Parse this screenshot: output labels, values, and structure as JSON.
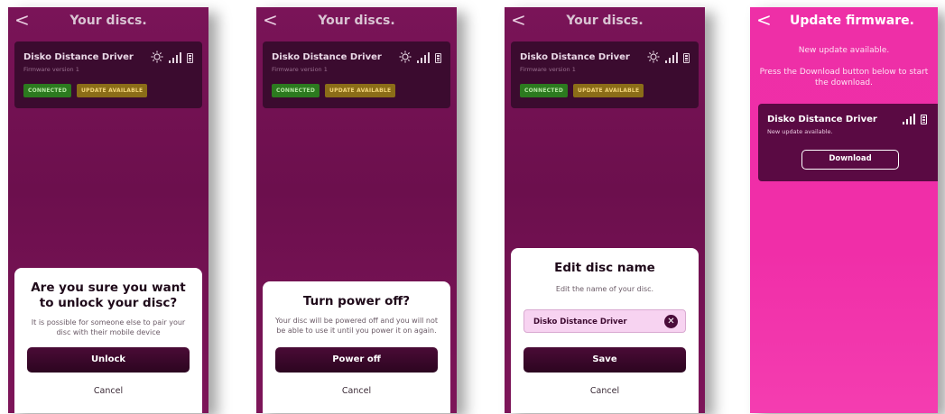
{
  "screens": [
    {
      "back": "<",
      "title": "Your discs.",
      "device": {
        "name": "Disko Distance Driver",
        "firmware": "Firmware version 1",
        "badge_connected": "CONNECTED",
        "badge_update": "UPDATE AVAILABLE"
      },
      "dialog": {
        "title": "Are you sure you want to unlock your disc?",
        "message": "It is possible for someone else to pair your disc with their mobile device",
        "primary": "Unlock",
        "cancel": "Cancel"
      }
    },
    {
      "back": "<",
      "title": "Your discs.",
      "device": {
        "name": "Disko Distance Driver",
        "firmware": "Firmware version 1",
        "badge_connected": "CONNECTED",
        "badge_update": "UPDATE AVAILABLE"
      },
      "dialog": {
        "title": "Turn power off?",
        "message": "Your disc will be powered off and you will not be able to use it until you power it on again.",
        "primary": "Power off",
        "cancel": "Cancel"
      }
    },
    {
      "back": "<",
      "title": "Your discs.",
      "device": {
        "name": "Disko Distance Driver",
        "firmware": "Firmware version 1",
        "badge_connected": "CONNECTED",
        "badge_update": "UPDATE AVAILABLE"
      },
      "dialog": {
        "title": "Edit disc name",
        "message": "Edit the name of your disc.",
        "input_value": "Disko Distance Driver",
        "primary": "Save",
        "cancel": "Cancel"
      }
    },
    {
      "back": "<",
      "title": "Update firmware.",
      "message1": "New update available.",
      "message2": "Press the Download button below to start the download.",
      "device": {
        "name": "Disko Distance Driver",
        "status": "New update available.",
        "button": "Download"
      }
    }
  ],
  "colors": {
    "accent_dark": "#6c0f4d",
    "accent_pink": "#f02ea8",
    "badge_connected": "#2c7a1f",
    "badge_update": "#8b6d18",
    "button_dark": "#3a0829"
  },
  "icons": [
    "chevron-left-icon",
    "gear-icon",
    "signal-icon",
    "battery-icon",
    "close-circle-icon"
  ]
}
